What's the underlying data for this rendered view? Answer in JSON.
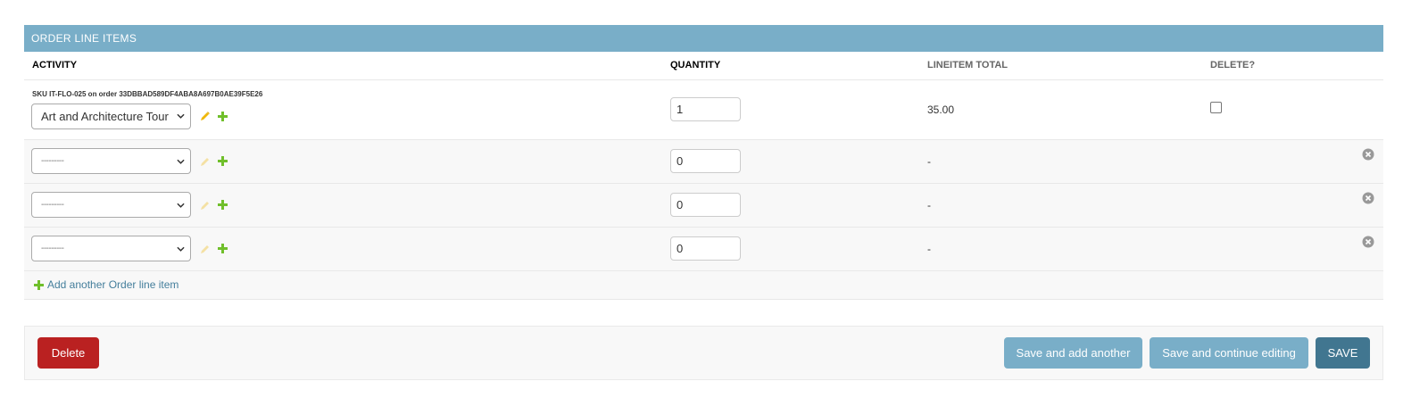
{
  "inline": {
    "title": "ORDER LINE ITEMS",
    "columns": {
      "activity": "ACTIVITY",
      "quantity": "QUANTITY",
      "total": "LINEITEM TOTAL",
      "delete": "DELETE?"
    },
    "rows": [
      {
        "caption": "SKU IT-FLO-025 on order 33DBBAD589DF4ABA8A697B0AE39F5E26",
        "activity": "Art and Architecture Tour",
        "quantity": "1",
        "total": "35.00",
        "delete_checked": false
      },
      {
        "activity": "---------",
        "quantity": "0",
        "total": "-"
      },
      {
        "activity": "---------",
        "quantity": "0",
        "total": "-"
      },
      {
        "activity": "---------",
        "quantity": "0",
        "total": "-"
      }
    ],
    "add_another_label": "Add another Order line item"
  },
  "actions": {
    "delete_label": "Delete",
    "save_add_another_label": "Save and add another",
    "save_continue_label": "Save and continue editing",
    "save_label": "SAVE"
  },
  "colors": {
    "header_bg": "#79aec8",
    "save_bg": "#417690",
    "delete_bg": "#ba2121",
    "add_green": "#70bf2b",
    "edit_yellow": "#efb80b",
    "link": "#447e9b"
  },
  "icons": {
    "edit": "pencil-icon",
    "add": "plus-icon",
    "remove": "remove-circle-icon",
    "select": "chevron-down-icon"
  }
}
